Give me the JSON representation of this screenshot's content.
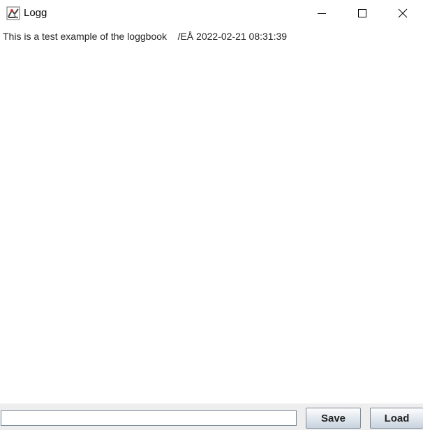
{
  "window": {
    "title": "Logg",
    "icon": "java-app-icon",
    "controls": {
      "minimize_icon": "minimize-icon",
      "maximize_icon": "maximize-icon",
      "close_icon": "close-icon"
    }
  },
  "log": {
    "entries": [
      "This is a test example of the loggbook    /EÅ 2022-02-21 08:31:39"
    ]
  },
  "bottom_bar": {
    "input_value": "",
    "save_label": "Save",
    "load_label": "Load"
  },
  "colors": {
    "background": "#ffffff",
    "bottom_bar": "#eeeeee",
    "button_border": "#7a8a99"
  }
}
